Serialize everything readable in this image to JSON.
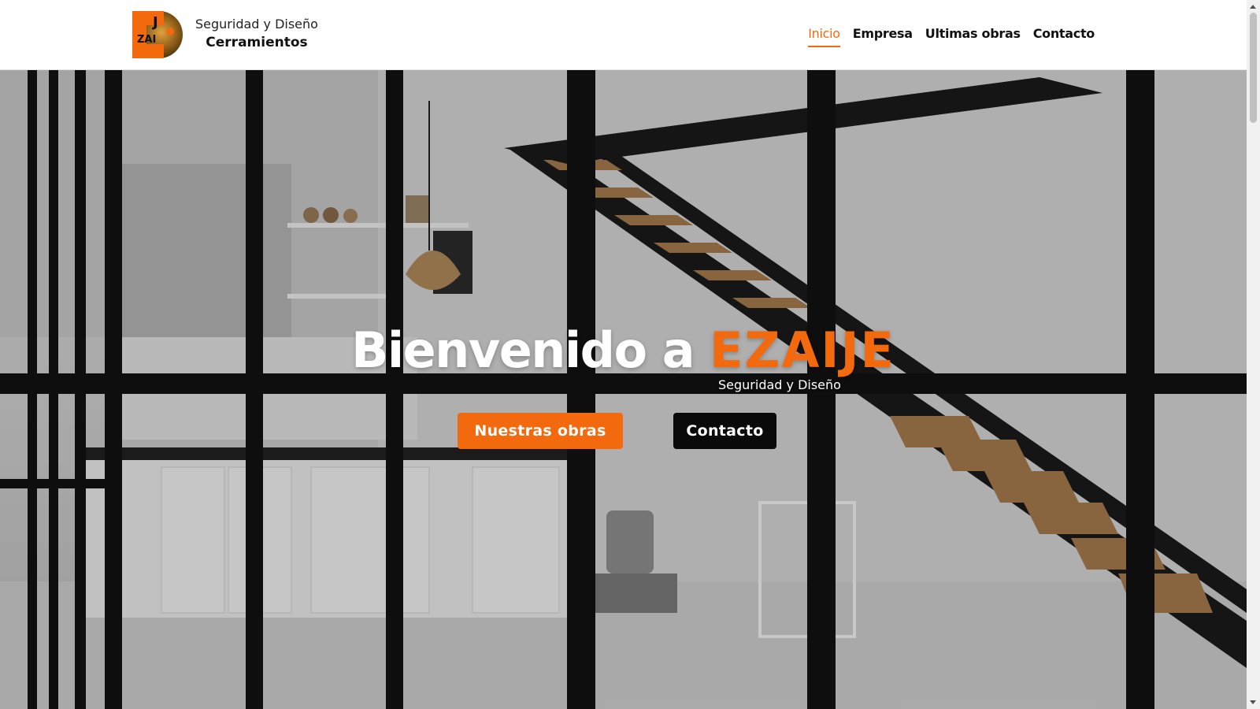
{
  "brand": {
    "line1": "Seguridad y Diseño",
    "line2": "Cerramientos",
    "logo_text": "EZAIJE",
    "logo_icon": "ezaije-logo"
  },
  "nav": {
    "items": [
      {
        "label": "Inicio",
        "active": true
      },
      {
        "label": "Empresa",
        "active": false
      },
      {
        "label": "Ultimas obras",
        "active": false
      },
      {
        "label": "Contacto",
        "active": false
      }
    ]
  },
  "hero": {
    "title_prefix": "Bienvenido a ",
    "title_accent": "EZAIJE",
    "subtitle": "Seguridad y Diseño",
    "primary_button": "Nuestras obras",
    "secondary_button": "Contacto"
  },
  "colors": {
    "accent": "#f26a0d",
    "dark": "#0a0a0a",
    "header_bg": "#ffffff"
  }
}
